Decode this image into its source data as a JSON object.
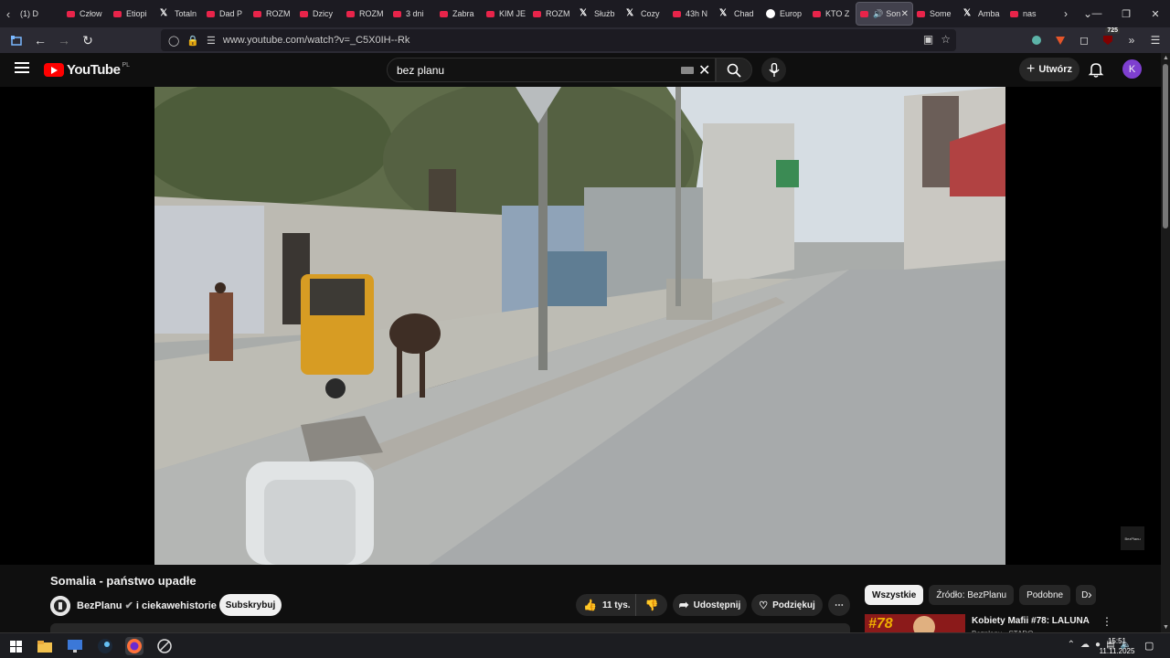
{
  "browser": {
    "tabs": [
      {
        "label": "(1) D",
        "icon": "none"
      },
      {
        "label": "Człow",
        "icon": "youtube"
      },
      {
        "label": "Etiopi",
        "icon": "youtube"
      },
      {
        "label": "Totaln",
        "icon": "x"
      },
      {
        "label": "Dad P",
        "icon": "youtube"
      },
      {
        "label": "ROZM",
        "icon": "youtube"
      },
      {
        "label": "Dzicy",
        "icon": "youtube"
      },
      {
        "label": "ROZM",
        "icon": "youtube"
      },
      {
        "label": "3 dni",
        "icon": "youtube"
      },
      {
        "label": "Zabra",
        "icon": "youtube"
      },
      {
        "label": "KIM JE",
        "icon": "youtube"
      },
      {
        "label": "ROZM",
        "icon": "youtube"
      },
      {
        "label": "Służb",
        "icon": "x"
      },
      {
        "label": "Cozy",
        "icon": "x"
      },
      {
        "label": "43h N",
        "icon": "youtube"
      },
      {
        "label": "Chad",
        "icon": "x"
      },
      {
        "label": "Europ",
        "icon": "globe"
      },
      {
        "label": "KTO Z",
        "icon": "youtube"
      },
      {
        "label": "Son",
        "icon": "youtube",
        "active": true
      },
      {
        "label": "Some",
        "icon": "youtube"
      },
      {
        "label": "Amba",
        "icon": "x"
      },
      {
        "label": "nas",
        "icon": "youtube"
      }
    ],
    "url": "www.youtube.com/watch?v=_C5X0IH--Rk",
    "extension_badge": "725"
  },
  "youtube": {
    "logo_text": "YouTube",
    "logo_region": "PL",
    "search_value": "bez planu",
    "create_label": "Utwórz",
    "avatar_letter": "K",
    "watermark": "BezPlanu"
  },
  "video": {
    "title": "Somalia - państwo upadłe",
    "channel": "BezPlanu",
    "collab": "i ciekawehistorie",
    "subscribe_label": "Subskrybuj",
    "likes": "11 tys.",
    "share_label": "Udostępnij",
    "thanks_label": "Podziękuj"
  },
  "chips": [
    "Wszystkie",
    "Źródło: BezPlanu",
    "Podobne",
    "D"
  ],
  "recommendation": {
    "number": "#78",
    "title": "Kobiety Mafii #78: LALUNA",
    "channel": "Bezplanu · STADO"
  },
  "taskbar": {
    "time": "15:51",
    "date": "11.11.2025"
  },
  "colors": {
    "youtube_red": "#ff0000",
    "avatar": "#7e3fcf",
    "page_bg": "#0f0f0f"
  }
}
